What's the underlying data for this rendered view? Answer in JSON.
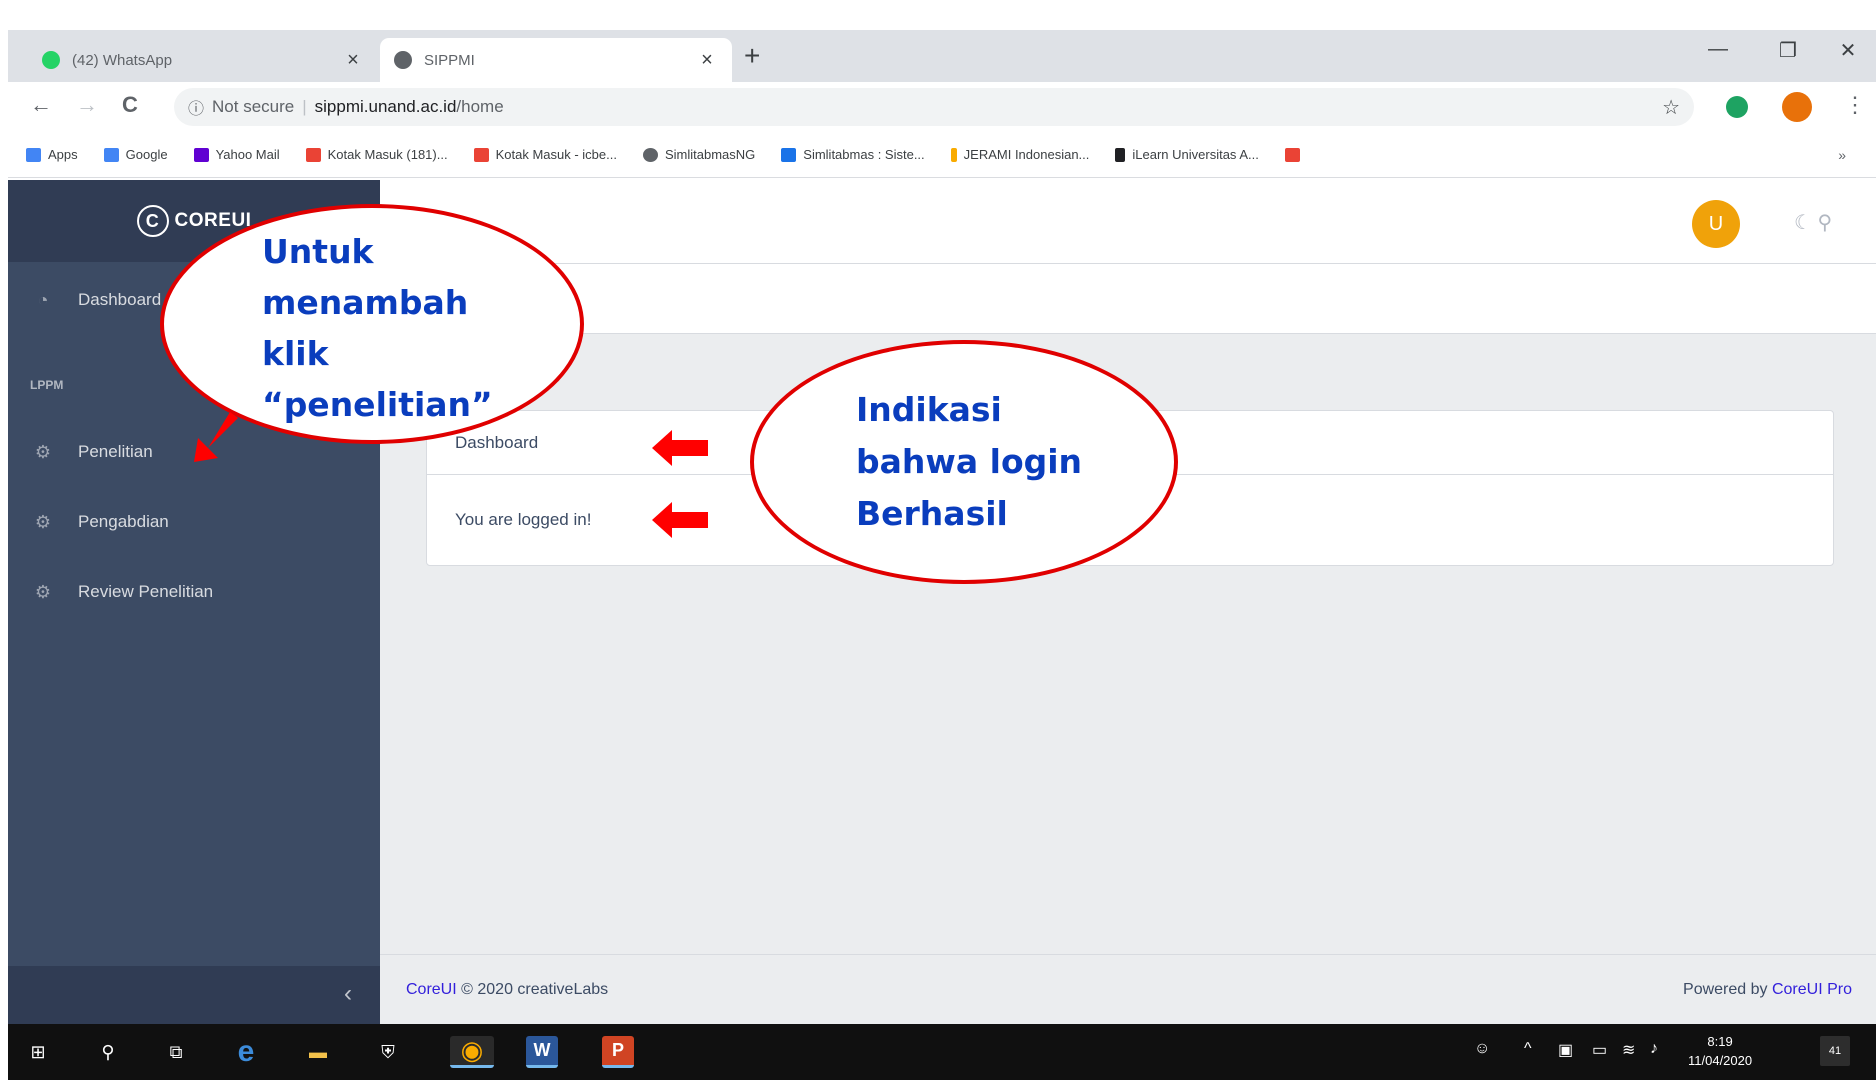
{
  "browser": {
    "tabs": [
      {
        "title": "(42) WhatsApp",
        "favicon_color": "#25d366",
        "active": false
      },
      {
        "title": "SIPPMI",
        "favicon_color": "#5f6368",
        "active": true
      }
    ],
    "new_tab_label": "+",
    "tab_close_glyph": "×",
    "window_controls": {
      "minimize": "—",
      "maximize": "❐",
      "close": "✕"
    },
    "nav": {
      "back": "←",
      "forward": "→",
      "reload": "C"
    },
    "address": {
      "info_glyph": "ⓘ",
      "security": "Not secure",
      "separator": "|",
      "host": "sippmi.unand.ac.id",
      "path": "/home",
      "star_glyph": "☆"
    },
    "menu_glyph": "⋮",
    "bookmarks": [
      {
        "label": "Apps",
        "color": "#4285f4"
      },
      {
        "label": "Google",
        "color": "#4285f4"
      },
      {
        "label": "Yahoo Mail",
        "color": "#6001d2"
      },
      {
        "label": "Kotak Masuk (181)...",
        "color": "#ea4335"
      },
      {
        "label": "Kotak Masuk - icbe...",
        "color": "#ea4335"
      },
      {
        "label": "SimlitabmasNG",
        "color": "#5f6368"
      },
      {
        "label": "Simlitabmas : Siste...",
        "color": "#1a73e8"
      },
      {
        "label": "JERAMI Indonesian...",
        "color": "#f9ab00"
      },
      {
        "label": "iLearn Universitas A...",
        "color": "#202124"
      },
      {
        "label": "",
        "color": "#ea4335"
      }
    ],
    "bookmarks_more": "»"
  },
  "app": {
    "brand": "COREUI",
    "brand_logo_letter": "C",
    "sidebar": {
      "dashboard": {
        "label": "Dashboard",
        "icon": "speedometer-icon",
        "glyph": "◔"
      },
      "section_title": "LPPM",
      "items": [
        {
          "label": "Penelitian",
          "icon": "puzzle-icon",
          "glyph": "⚙"
        },
        {
          "label": "Pengabdian",
          "icon": "puzzle-icon",
          "glyph": "⚙"
        },
        {
          "label": "Review Penelitian",
          "icon": "puzzle-icon",
          "glyph": "⚙"
        }
      ],
      "toggler_glyph": "‹"
    },
    "header": {
      "avatar_letter": "U",
      "icons_glyph": "☾ ⚲"
    },
    "card": {
      "header": "Dashboard",
      "body": "You are logged in!"
    },
    "footer": {
      "left_link": "CoreUI",
      "left_text": "© 2020 creativeLabs",
      "right_text": "Powered by",
      "right_link": "CoreUI Pro"
    }
  },
  "taskbar": {
    "clock_time": "8:19",
    "clock_date": "11/04/2020",
    "notification_count": "41",
    "apps": [
      {
        "name": "start",
        "glyph": "⊞"
      },
      {
        "name": "search",
        "glyph": "⚲"
      },
      {
        "name": "task-view",
        "glyph": "⧉"
      },
      {
        "name": "edge",
        "glyph": "e"
      },
      {
        "name": "file-explorer",
        "glyph": "▬"
      },
      {
        "name": "security",
        "glyph": "⛨"
      },
      {
        "name": "chrome",
        "glyph": "◉"
      },
      {
        "name": "word",
        "glyph": "W"
      },
      {
        "name": "powerpoint",
        "glyph": "P"
      }
    ]
  },
  "annotations": {
    "left_callout": [
      "Untuk",
      "menambah",
      "klik",
      "“penelitian”"
    ],
    "right_callout": [
      "Indikasi",
      "bahwa login",
      "Berhasil"
    ],
    "arrow_color": "#ff0000"
  }
}
